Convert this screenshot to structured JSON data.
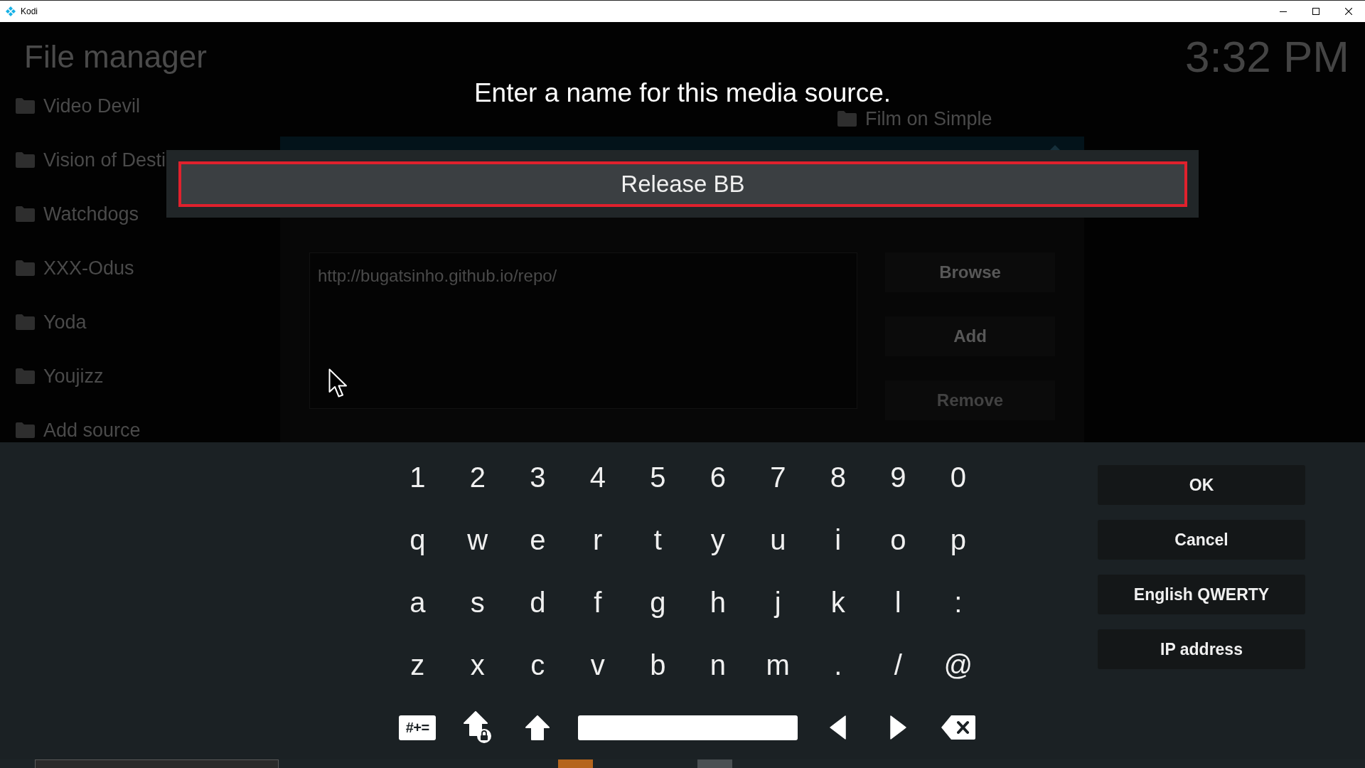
{
  "window": {
    "title": "Kodi"
  },
  "background": {
    "heading": "File manager",
    "clock": "3:32 PM",
    "sources_left": [
      "Video Devil",
      "Vision of Desti",
      "Watchdogs",
      "XXX-Odus",
      "Yoda",
      "Youjizz",
      "Add source"
    ],
    "sources_right": [
      "Film on Simple"
    ],
    "add_source_dialog": {
      "path": "http://bugatsinho.github.io/repo/",
      "buttons": [
        {
          "label": "Browse",
          "disabled": false
        },
        {
          "label": "Add",
          "disabled": false
        },
        {
          "label": "Remove",
          "disabled": true
        }
      ]
    }
  },
  "keyboard_dialog": {
    "heading": "Enter a name for this media source.",
    "input": {
      "value": "Release BB",
      "focused": true
    },
    "key_rows": [
      [
        "1",
        "2",
        "3",
        "4",
        "5",
        "6",
        "7",
        "8",
        "9",
        "0"
      ],
      [
        "q",
        "w",
        "e",
        "r",
        "t",
        "y",
        "u",
        "i",
        "o",
        "p"
      ],
      [
        "a",
        "s",
        "d",
        "f",
        "g",
        "h",
        "j",
        "k",
        "l",
        ":"
      ],
      [
        "z",
        "x",
        "c",
        "v",
        "b",
        "n",
        "m",
        ".",
        "/",
        "@"
      ]
    ],
    "function_keys": [
      {
        "kind": "symbols",
        "label": "#+="
      },
      {
        "kind": "caps_lock"
      },
      {
        "kind": "shift"
      },
      {
        "kind": "space"
      },
      {
        "kind": "cursor_left"
      },
      {
        "kind": "cursor_right"
      },
      {
        "kind": "backspace"
      }
    ],
    "buttons": [
      "OK",
      "Cancel",
      "English QWERTY",
      "IP address"
    ]
  }
}
